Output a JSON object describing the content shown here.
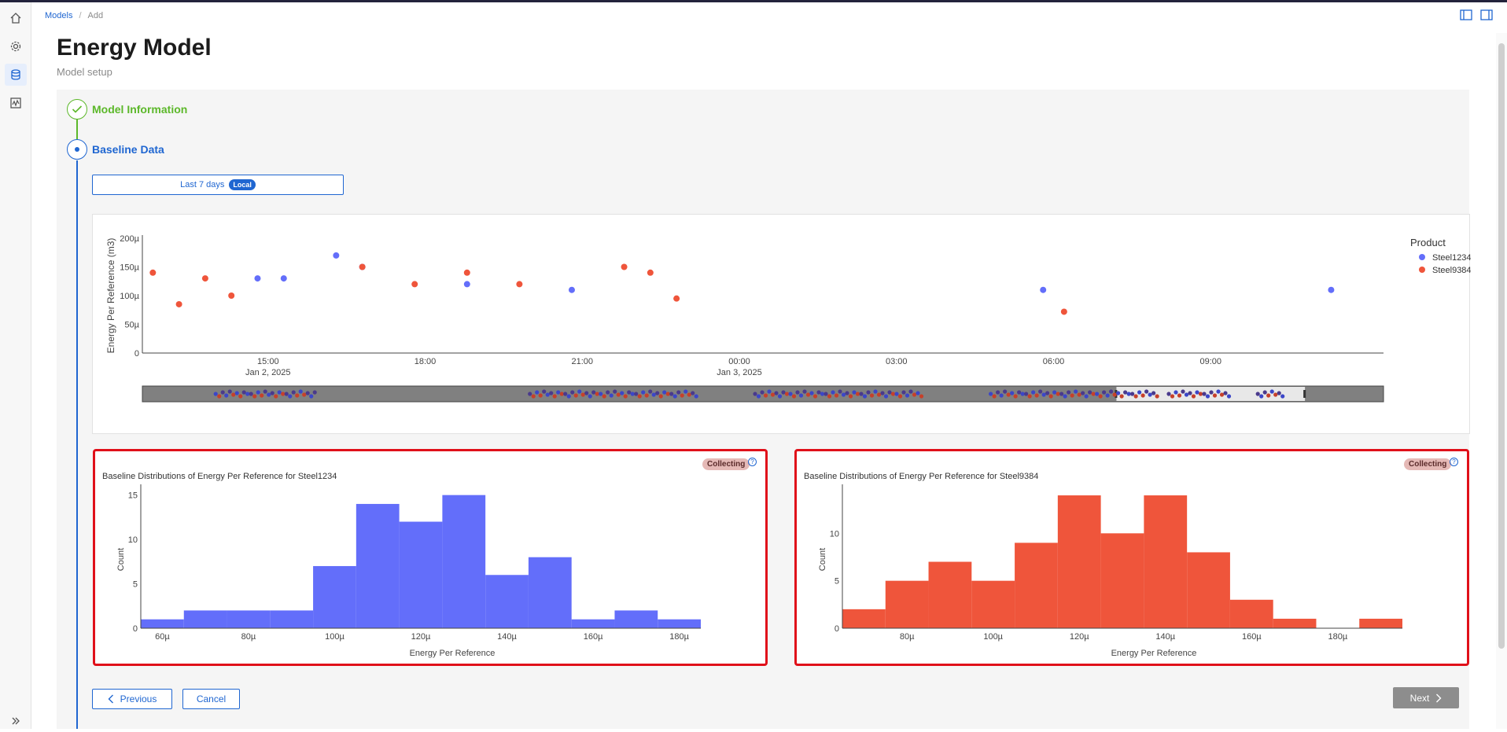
{
  "breadcrumb": {
    "root": "Models",
    "current": "Add"
  },
  "page": {
    "title": "Energy Model",
    "subtitle": "Model setup"
  },
  "steps": [
    {
      "label": "Model Information",
      "state": "done",
      "color": "#5cb82a"
    },
    {
      "label": "Baseline Data",
      "state": "active",
      "color": "#1f66d1"
    }
  ],
  "time_range": {
    "label": "Last 7 days",
    "badge": "Local"
  },
  "colors": {
    "steel1234": "#636efa",
    "steel9384": "#ef553b",
    "accent": "#1f66d1"
  },
  "chart_data": [
    {
      "type": "scatter",
      "title": "",
      "ylabel": "Energy Per Reference (m3)",
      "ylim": [
        0,
        200
      ],
      "yticks": [
        "0",
        "50µ",
        "100µ",
        "150µ",
        "200µ"
      ],
      "xticks": [
        {
          "label": "15:00",
          "sub": "Jan 2, 2025"
        },
        {
          "label": "18:00",
          "sub": ""
        },
        {
          "label": "21:00",
          "sub": ""
        },
        {
          "label": "00:00",
          "sub": "Jan 3, 2025"
        },
        {
          "label": "03:00",
          "sub": ""
        },
        {
          "label": "06:00",
          "sub": ""
        },
        {
          "label": "09:00",
          "sub": ""
        }
      ],
      "x_unit": "hours since Jan 2, 2025 12:00",
      "legend_title": "Product",
      "legend_position": "right",
      "series": [
        {
          "name": "Steel1234",
          "color": "#636efa",
          "points": [
            [
              14.8,
              130
            ],
            [
              15.3,
              130
            ],
            [
              16.3,
              170
            ],
            [
              16.8,
              150
            ],
            [
              18.8,
              120
            ],
            [
              20.8,
              110
            ],
            [
              29.8,
              110
            ],
            [
              35.3,
              110
            ]
          ]
        },
        {
          "name": "Steel9384",
          "color": "#ef553b",
          "points": [
            [
              12.8,
              140
            ],
            [
              13.3,
              85
            ],
            [
              13.8,
              130
            ],
            [
              14.3,
              100
            ],
            [
              16.8,
              150
            ],
            [
              17.8,
              120
            ],
            [
              18.8,
              140
            ],
            [
              19.8,
              120
            ],
            [
              21.8,
              150
            ],
            [
              22.3,
              140
            ],
            [
              22.8,
              95
            ],
            [
              30.2,
              72
            ]
          ]
        }
      ]
    },
    {
      "type": "bar",
      "title": "Baseline Distributions of Energy Per Reference for Steel1234",
      "xlabel": "Energy Per Reference",
      "ylabel": "Count",
      "xticks": [
        "60µ",
        "80µ",
        "100µ",
        "120µ",
        "140µ",
        "160µ",
        "180µ"
      ],
      "xlim": [
        55,
        185
      ],
      "ylim": [
        0,
        15.5
      ],
      "yticks": [
        "0",
        "5",
        "10",
        "15"
      ],
      "bin_edges": [
        55,
        65,
        75,
        85,
        95,
        105,
        115,
        125,
        135,
        145,
        155,
        165,
        175,
        185
      ],
      "values": [
        1,
        2,
        2,
        2,
        7,
        14,
        12,
        15,
        6,
        8,
        1,
        2,
        1
      ],
      "color": "#636efa",
      "status": "Collecting"
    },
    {
      "type": "bar",
      "title": "Baseline Distributions of Energy Per Reference for Steel9384",
      "xlabel": "Energy Per Reference",
      "ylabel": "Count",
      "xticks": [
        "80µ",
        "100µ",
        "120µ",
        "140µ",
        "160µ",
        "180µ"
      ],
      "xlim": [
        65,
        195
      ],
      "ylim": [
        0,
        14.5
      ],
      "yticks": [
        "0",
        "5",
        "10"
      ],
      "bin_edges": [
        65,
        75,
        85,
        95,
        105,
        115,
        125,
        135,
        145,
        155,
        165,
        175,
        185,
        195
      ],
      "values": [
        2,
        5,
        7,
        5,
        9,
        14,
        10,
        14,
        8,
        3,
        1,
        0,
        1
      ],
      "color": "#ef553b",
      "status": "Collecting"
    }
  ],
  "buttons": {
    "previous": "Previous",
    "cancel": "Cancel",
    "next": "Next"
  }
}
